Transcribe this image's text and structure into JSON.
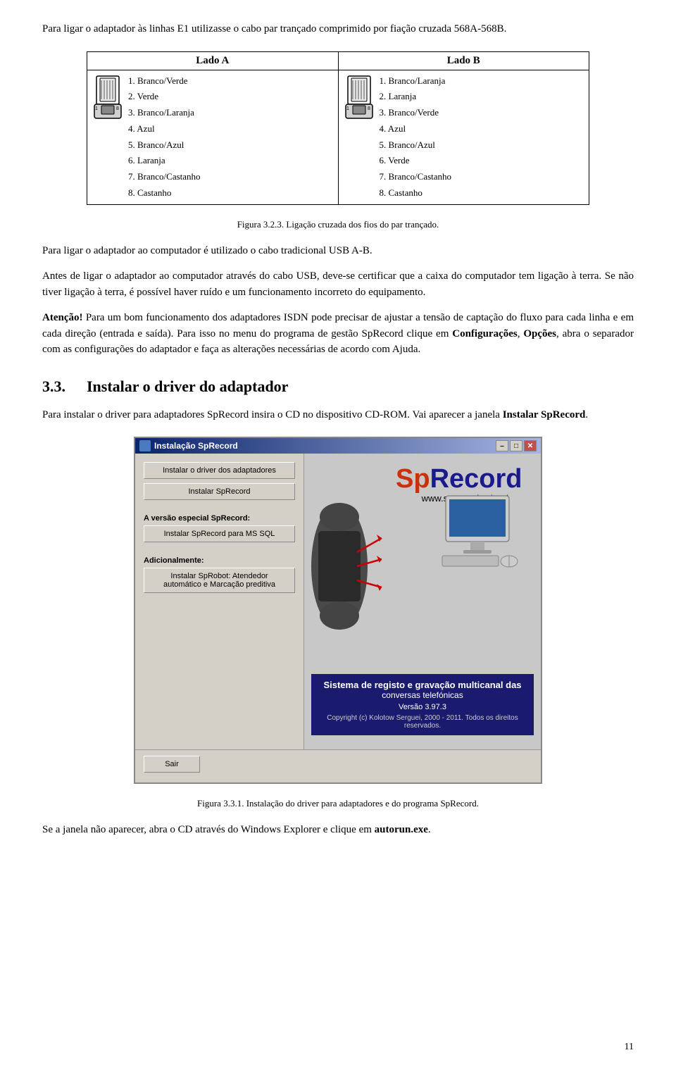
{
  "intro": {
    "text": "Para ligar o adaptador às linhas E1 utilizasse o cabo par trançado comprimido por fiação cruzada 568A-568B."
  },
  "table": {
    "header_a": "Lado A",
    "header_b": "Lado B",
    "side_a_items": [
      "1. Branco/Verde",
      "2. Verde",
      "3. Branco/Laranja",
      "4. Azul",
      "5. Branco/Azul",
      "6. Laranja",
      "7. Branco/Castanho",
      "8. Castanho"
    ],
    "side_b_items": [
      "1. Branco/Laranja",
      "2. Laranja",
      "3. Branco/Verde",
      "4. Azul",
      "5. Branco/Azul",
      "6. Verde",
      "7. Branco/Castanho",
      "8. Castanho"
    ],
    "label_1": "1",
    "label_8": "8"
  },
  "figure_caption_1": "Figura 3.2.3. Ligação cruzada dos fios do par trançado.",
  "para_usb": "Para ligar o adaptador ao computador é utilizado o cabo tradicional USB A-B.",
  "para_before": "Antes de ligar o adaptador ao computador através do cabo USB, deve-se certificar que a caixa do computador tem ligação à terra. Se não tiver ligação à terra, é possível haver ruído e um funcionamento incorreto do equipamento.",
  "attention": {
    "label": "Atenção!",
    "text1": " Para um bom funcionamento dos adaptadores ISDN pode precisar de ajustar a tensão de captação do fluxo para cada linha e em cada direção (entrada e saída). Para isso no menu do programa de gestão SpRecord clique em ",
    "bold1": "Configurações",
    "sep1": ", ",
    "bold2": "Opções",
    "text2": ", abra o separador com as configurações do adaptador e faça as alterações necessárias de acordo com Ajuda."
  },
  "section": {
    "number": "3.3.",
    "title": "Instalar o driver do adaptador"
  },
  "para_install1": "Para instalar o driver para adaptadores SpRecord insira o CD no dispositivo CD-ROM. Vai aparecer a janela ",
  "bold_install": "Instalar SpRecord",
  "para_install2": ".",
  "installer": {
    "title": "Instalação SpRecord",
    "btn1": "Instalar o driver dos adaptadores",
    "section1_label": "A versão especial SpRecord:",
    "btn2": "Instalar SpRecord",
    "btn3": "Instalar SpRecord para MS SQL",
    "section2_label": "Adicionalmente:",
    "btn4": "Instalar SpRobot: Atendedor\nautomático e Marcação preditiva",
    "btn_exit": "Sair",
    "logo_sp": "Sp",
    "logo_record": "Record",
    "url": "www.sprecord.ru/por/",
    "bottom_title": "Sistema de registo e gravação multicanal das",
    "bottom_subtitle": "conversas telefónicas",
    "bottom_version": "Versão 3.97.3",
    "bottom_copyright": "Copyright (c) Kolotow Serguei, 2000 - 2011. Todos os direitos reservados."
  },
  "figure_caption_2": "Figura 3.3.1. Instalação do driver para adaptadores e do programa SpRecord.",
  "closing": {
    "text": "Se a janela não aparecer, abra o CD através do Windows Explorer e clique em ",
    "bold": "autorun.exe",
    "text2": "."
  },
  "page_number": "11"
}
